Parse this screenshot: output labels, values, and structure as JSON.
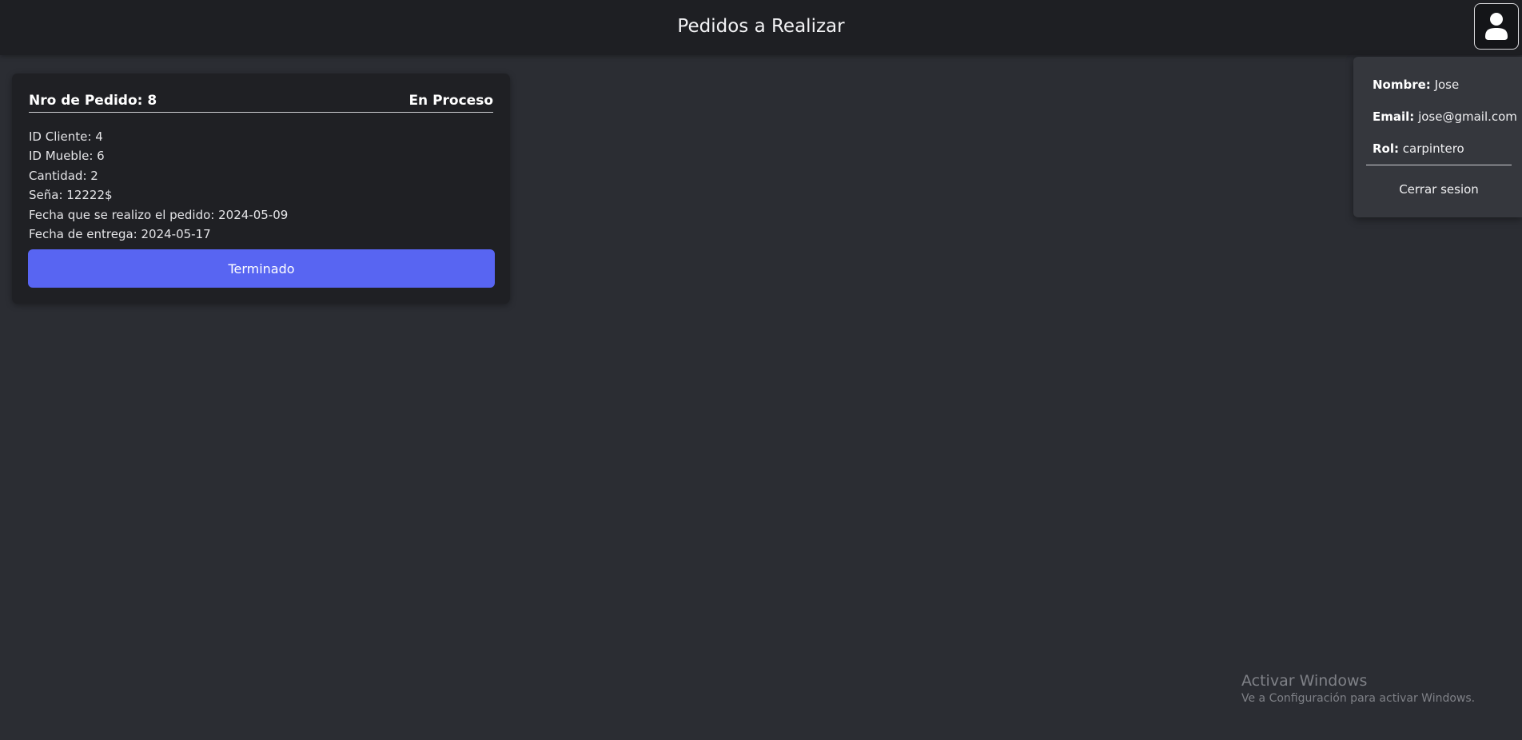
{
  "header": {
    "title": "Pedidos a Realizar",
    "user_icon": "user-icon"
  },
  "order": {
    "number_label": "Nro de Pedido: 8",
    "status": "En Proceso",
    "lines": [
      "ID Cliente: 4",
      "ID Mueble: 6",
      "Cantidad: 2",
      "Seña: 12222$",
      "Fecha que se realizo el pedido: 2024-05-09",
      "Fecha de entrega: 2024-05-17"
    ],
    "button_label": "Terminado"
  },
  "user_panel": {
    "name_label": "Nombre:",
    "name_value": "Jose",
    "email_label": "Email:",
    "email_value": "jose@gmail.com",
    "role_label": "Rol:",
    "role_value": "carpintero",
    "logout_label": "Cerrar sesion"
  },
  "watermark": {
    "title": "Activar Windows",
    "subtitle": "Ve a Configuración para activar Windows."
  },
  "colors": {
    "page_bg": "#2b2d33",
    "topbar_bg": "#1e1f23",
    "card_bg": "#1f2024",
    "panel_bg": "#35373d",
    "accent": "#5865f2"
  }
}
